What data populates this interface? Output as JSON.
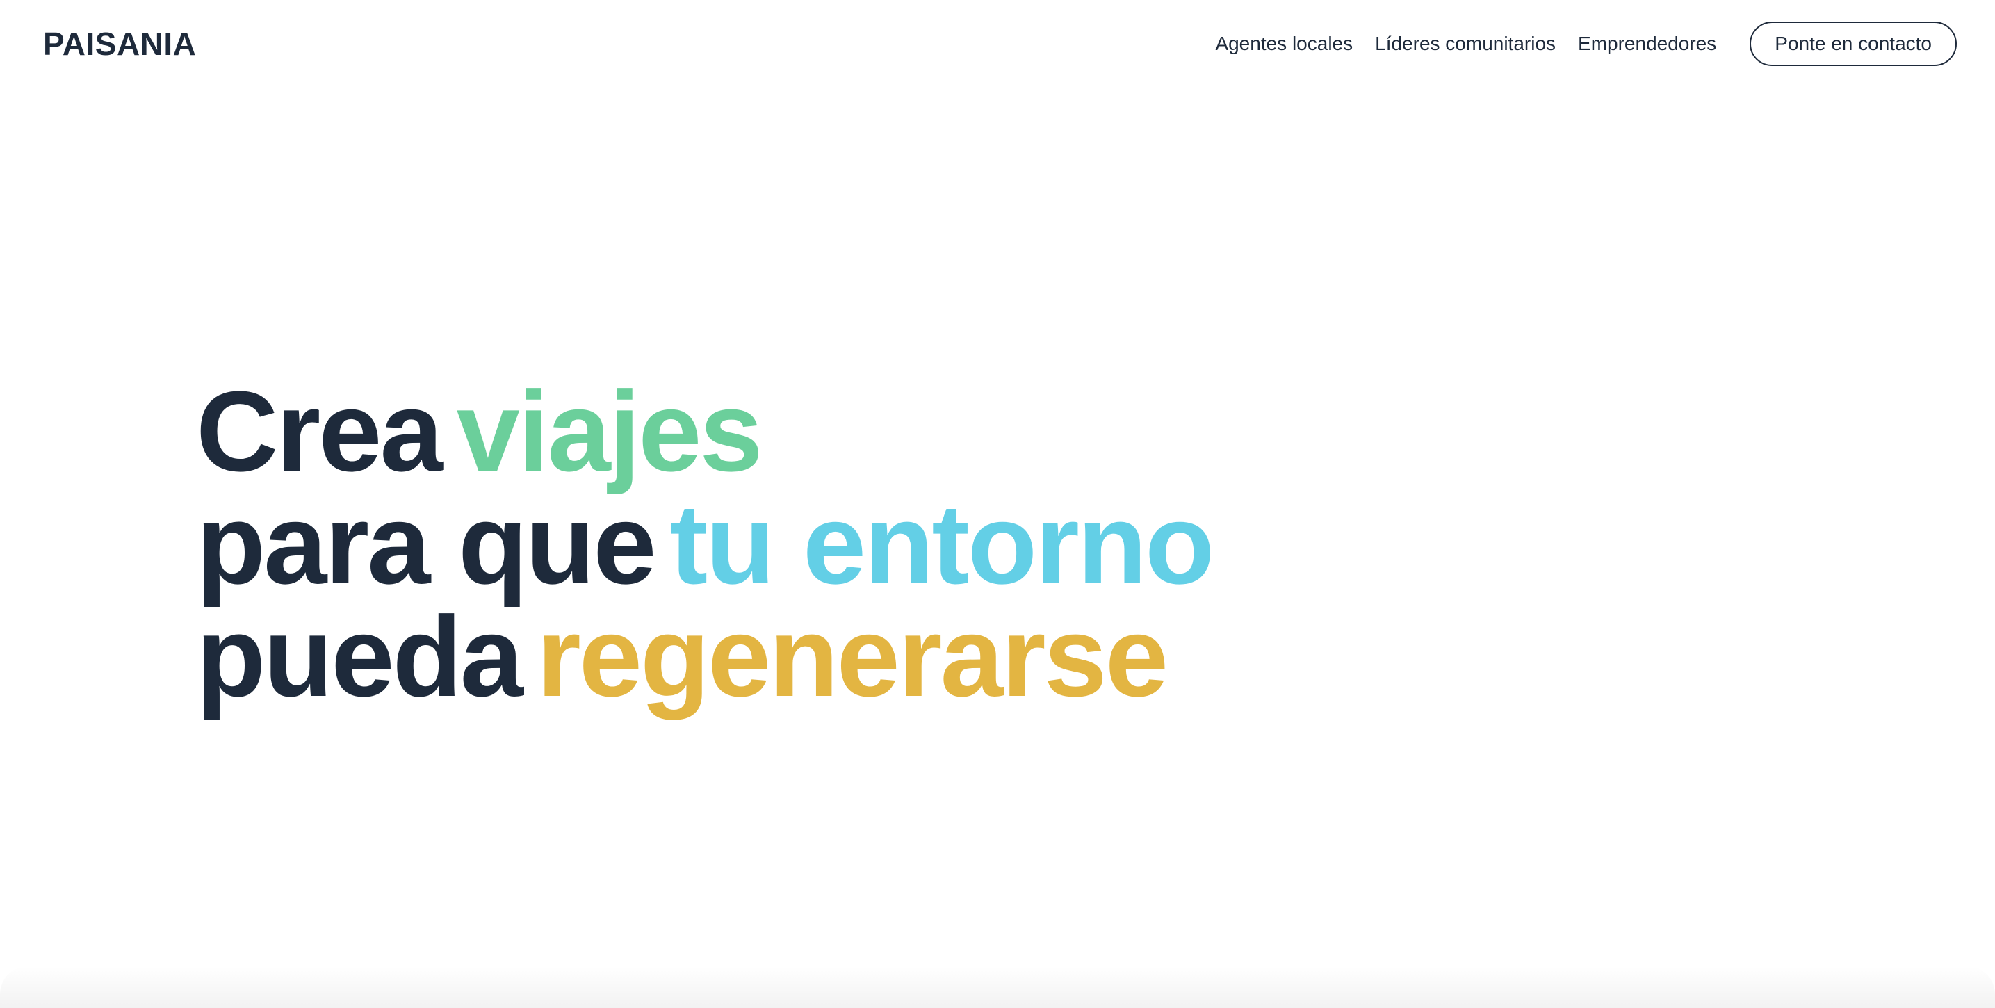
{
  "header": {
    "logo": "PAISANIA",
    "nav": [
      {
        "label": "Agentes locales"
      },
      {
        "label": "Líderes comunitarios"
      },
      {
        "label": "Emprendedores"
      }
    ],
    "contact_button": "Ponte en contacto"
  },
  "hero": {
    "lines": [
      {
        "lead": "Crea",
        "highlight": "viajes"
      },
      {
        "lead": "para que",
        "highlight": "tu entorno"
      },
      {
        "lead": "pueda",
        "highlight": "regenerarse"
      }
    ]
  },
  "colors": {
    "text_dark": "#1e2a3b",
    "accent_green": "#6bcf9b",
    "accent_blue": "#63cfe6",
    "accent_yellow": "#e3b542",
    "background": "#ffffff"
  }
}
